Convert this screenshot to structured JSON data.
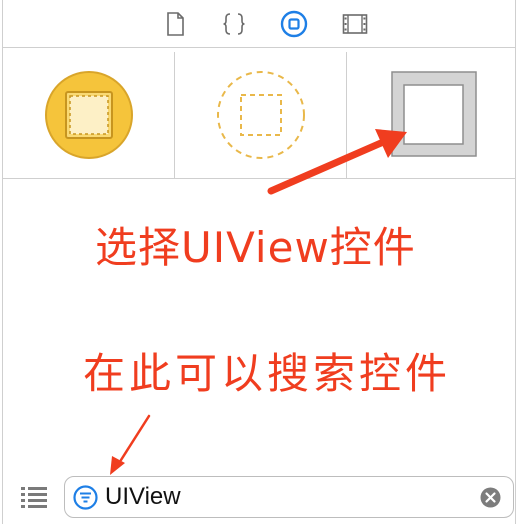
{
  "tabs": [
    {
      "name": "file-inspector",
      "icon": "document-icon",
      "active": false
    },
    {
      "name": "quick-help",
      "icon": "braces-icon",
      "active": false
    },
    {
      "name": "object-library",
      "icon": "square-in-circle-icon",
      "active": true
    },
    {
      "name": "media-library",
      "icon": "film-strip-icon",
      "active": false
    }
  ],
  "library_items": [
    {
      "icon": "view-controller-icon",
      "color": "#f5c43b"
    },
    {
      "icon": "storyboard-reference-icon",
      "color": "#e9b84a"
    },
    {
      "icon": "uiview-icon",
      "color": "#d4d4d4"
    }
  ],
  "annotations": {
    "select_view": "选择UIView控件",
    "search_here": "在此可以搜索控件"
  },
  "search": {
    "value": "UIView",
    "placeholder": ""
  },
  "colors": {
    "accent": "#1e7fe6",
    "annotation": "#f03d1f"
  }
}
